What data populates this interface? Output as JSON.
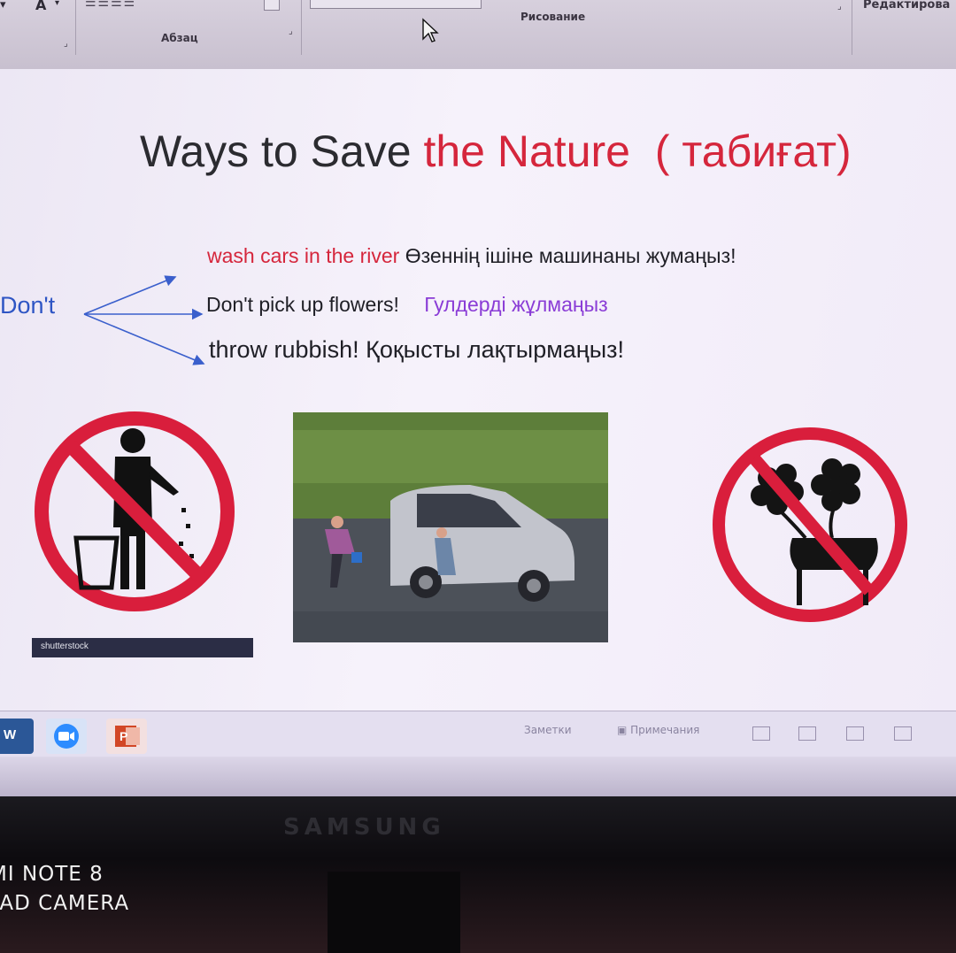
{
  "ribbon": {
    "font_dropdown": "A",
    "group_paragraph": "Абзац",
    "group_drawing": "Рисование",
    "group_editing": "Редактирова"
  },
  "slide": {
    "title_part1": "Ways to Save ",
    "title_part2": "the Nature",
    "title_part3": "( табиғат)",
    "dont_label": "Don't",
    "line1_en": "wash cars in the river",
    "line1_kz": "Өзеннің ішіне машинаны жумаңыз!",
    "line2_en": "Don't pick up flowers!",
    "line2_kz": "Гулдерді жұлмаңыз",
    "line3_en": "throw  rubbish!",
    "line3_kz": "Қоқысты лақтырмаңыз!",
    "watermark": "shutterstock",
    "colors": {
      "title_accent": "#d5263c",
      "dont": "#2e55c4",
      "purple": "#8a3cd6",
      "prohibition": "#d91e3c"
    }
  },
  "statusbar": {
    "notes": "Заметки",
    "comments": "Примечания"
  },
  "taskbar": {
    "apps": [
      "word-icon",
      "zoom-icon",
      "powerpoint-icon"
    ],
    "word_letter": "W",
    "ppt_letter": "P"
  },
  "monitor": {
    "brand": "SAMSUNG"
  },
  "camera_watermark": {
    "line1": "MI NOTE 8",
    "line2": "JAD CAMERA"
  }
}
